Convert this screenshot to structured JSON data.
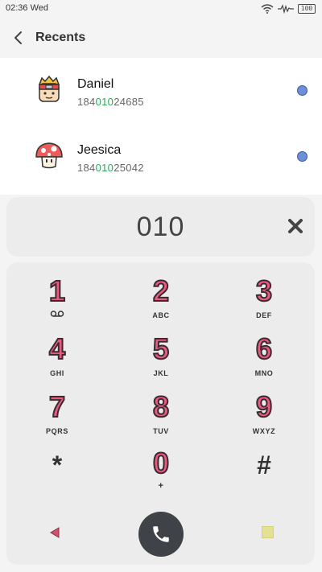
{
  "status_bar": {
    "time": "02:36 Wed",
    "battery": "100"
  },
  "header": {
    "title": "Recents"
  },
  "recents": [
    {
      "name": "Daniel",
      "number_prefix": "184",
      "number_match": "010",
      "number_suffix": "24685"
    },
    {
      "name": "Jeesica",
      "number_prefix": "184",
      "number_match": "010",
      "number_suffix": "25042"
    }
  ],
  "dialer": {
    "input": "010"
  },
  "keypad": [
    {
      "digit": "1",
      "letters": ""
    },
    {
      "digit": "2",
      "letters": "ABC"
    },
    {
      "digit": "3",
      "letters": "DEF"
    },
    {
      "digit": "4",
      "letters": "GHI"
    },
    {
      "digit": "5",
      "letters": "JKL"
    },
    {
      "digit": "6",
      "letters": "MNO"
    },
    {
      "digit": "7",
      "letters": "PQRS"
    },
    {
      "digit": "8",
      "letters": "TUV"
    },
    {
      "digit": "9",
      "letters": "WXYZ"
    },
    {
      "digit": "*",
      "letters": ""
    },
    {
      "digit": "0",
      "letters": "+"
    },
    {
      "digit": "#",
      "letters": ""
    }
  ],
  "colors": {
    "match_highlight": "#29a85a",
    "digit_fill": "#e95a7e",
    "call_button": "#3f4247",
    "dot": "#6d8fd8"
  }
}
